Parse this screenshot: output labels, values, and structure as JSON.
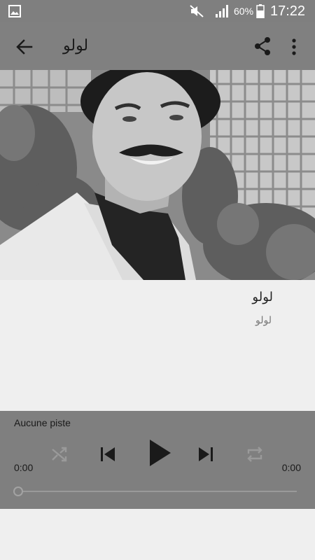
{
  "status_bar": {
    "battery_percent": "60%",
    "clock": "17:22",
    "icons": [
      "gallery-icon",
      "mute-icon",
      "signal-icon",
      "battery-icon"
    ]
  },
  "app_bar": {
    "title": "لولو",
    "icons": [
      "back-arrow-icon",
      "share-icon",
      "more-vert-icon"
    ]
  },
  "track": {
    "title": "لولو",
    "artist": "لولو"
  },
  "player": {
    "status_text": "Aucune piste",
    "elapsed": "0:00",
    "duration": "0:00",
    "progress": 0,
    "icons": [
      "shuffle-icon",
      "skip-previous-icon",
      "play-icon",
      "skip-next-icon",
      "repeat-icon"
    ]
  },
  "colors": {
    "bars": "#7f7f7f",
    "background": "#efefef",
    "icon_dark": "#1a1a1a",
    "icon_disabled": "#999999"
  }
}
